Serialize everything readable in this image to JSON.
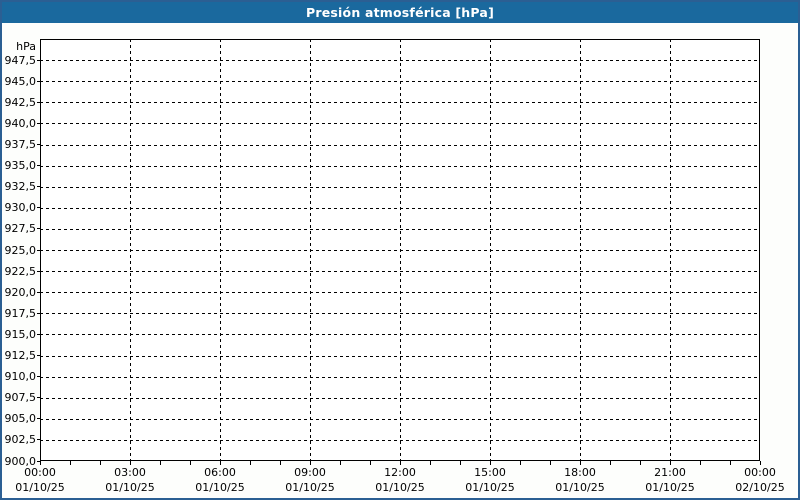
{
  "title": "Presión atmosférica [hPa]",
  "colors": {
    "title_bg": "#1a699e",
    "title_text": "#ffffff",
    "frame_border": "#2b5f93",
    "grid": "#000000",
    "axis": "#000000",
    "plot_bg": "#ffffff",
    "outer_bg": "#fdfefc"
  },
  "chart_data": {
    "type": "line",
    "title": "Presión atmosférica [hPa]",
    "ylabel": "hPa",
    "xlabel": "",
    "ylim": [
      900,
      950
    ],
    "ytick_step": 2.5,
    "grid": true,
    "legend": "none",
    "series": [],
    "no_data_plotted": true,
    "yticks": [
      {
        "value": 947.5,
        "label": "947,5"
      },
      {
        "value": 945.0,
        "label": "945,0"
      },
      {
        "value": 942.5,
        "label": "942,5"
      },
      {
        "value": 940.0,
        "label": "940,0"
      },
      {
        "value": 937.5,
        "label": "937,5"
      },
      {
        "value": 935.0,
        "label": "935,0"
      },
      {
        "value": 932.5,
        "label": "932,5"
      },
      {
        "value": 930.0,
        "label": "930,0"
      },
      {
        "value": 927.5,
        "label": "927,5"
      },
      {
        "value": 925.0,
        "label": "925,0"
      },
      {
        "value": 922.5,
        "label": "922,5"
      },
      {
        "value": 920.0,
        "label": "920,0"
      },
      {
        "value": 917.5,
        "label": "917,5"
      },
      {
        "value": 915.0,
        "label": "915,0"
      },
      {
        "value": 912.5,
        "label": "912,5"
      },
      {
        "value": 910.0,
        "label": "910,0"
      },
      {
        "value": 907.5,
        "label": "907,5"
      },
      {
        "value": 905.0,
        "label": "905,0"
      },
      {
        "value": 902.5,
        "label": "902,5"
      },
      {
        "value": 900.0,
        "label": "900,0"
      }
    ],
    "xlim_hours": [
      0,
      24
    ],
    "minor_xtick_every_hours": 1,
    "major_xtick_every_hours": 3,
    "xticks": [
      {
        "hour": 0,
        "time": "00:00",
        "date": "01/10/25"
      },
      {
        "hour": 3,
        "time": "03:00",
        "date": "01/10/25"
      },
      {
        "hour": 6,
        "time": "06:00",
        "date": "01/10/25"
      },
      {
        "hour": 9,
        "time": "09:00",
        "date": "01/10/25"
      },
      {
        "hour": 12,
        "time": "12:00",
        "date": "01/10/25"
      },
      {
        "hour": 15,
        "time": "15:00",
        "date": "01/10/25"
      },
      {
        "hour": 18,
        "time": "18:00",
        "date": "01/10/25"
      },
      {
        "hour": 21,
        "time": "21:00",
        "date": "01/10/25"
      },
      {
        "hour": 24,
        "time": "00:00",
        "date": "02/10/25"
      }
    ]
  }
}
